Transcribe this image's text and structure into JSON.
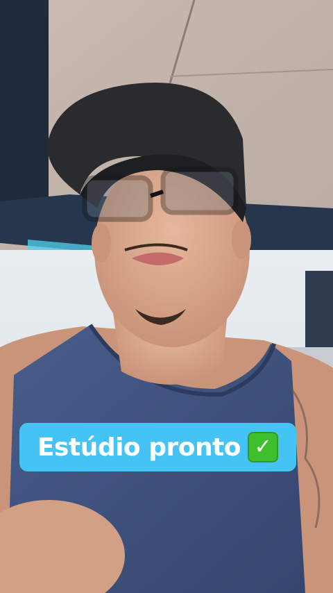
{
  "caption": {
    "text": "Estúdio pronto",
    "icon": "check-mark-button-emoji",
    "icon_glyph": "✓"
  },
  "colors": {
    "caption_background": "#45c3f4",
    "caption_text": "#ffffff",
    "check_background": "#3ebf2e"
  }
}
